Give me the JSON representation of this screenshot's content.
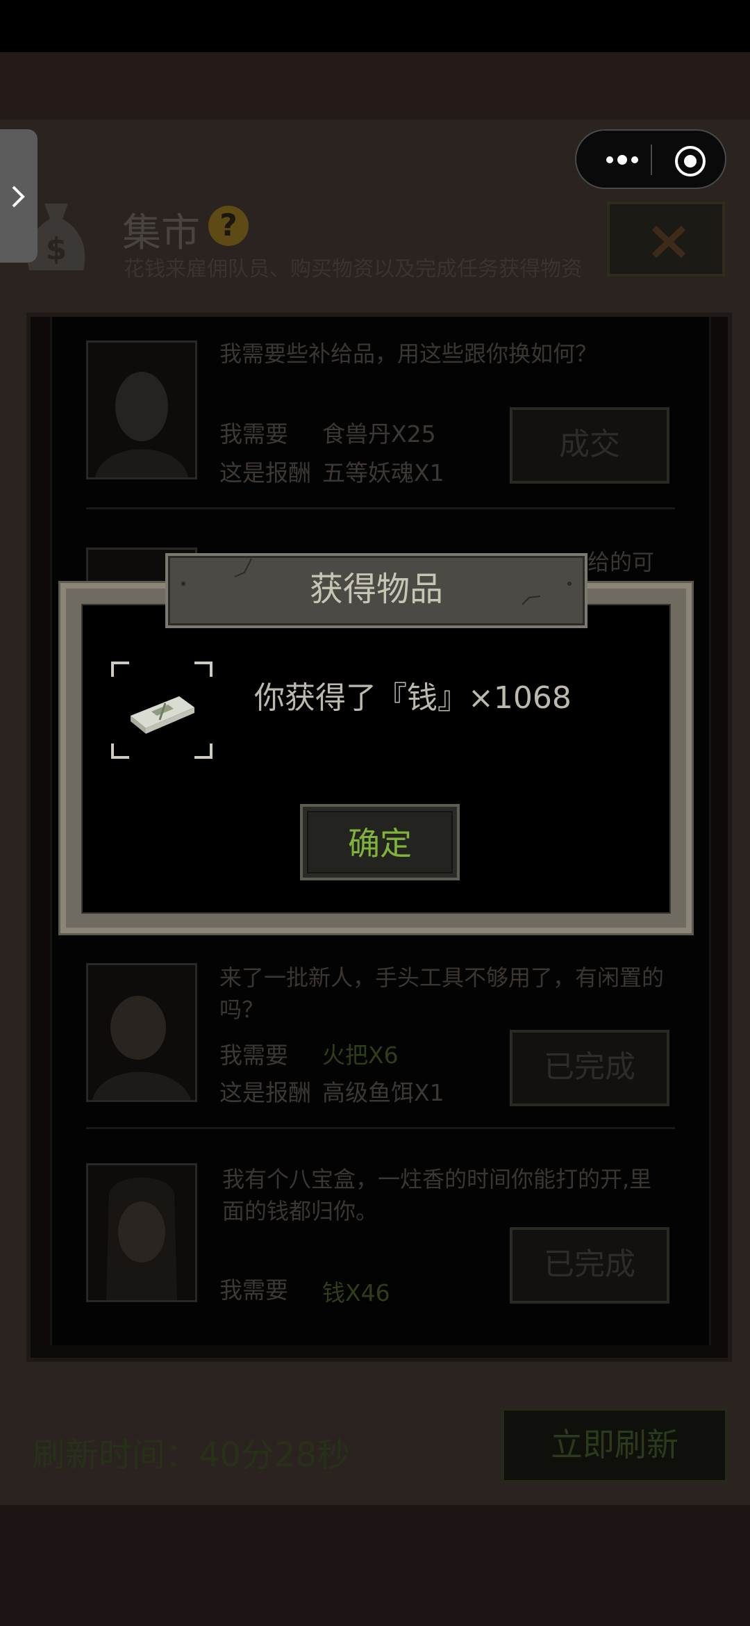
{
  "header": {
    "title": "集市",
    "help": "?",
    "subtitle": "花钱来雇佣队员、购买物资以及完成任务获得物资"
  },
  "trades": [
    {
      "text": "我需要些补给品，用这些跟你换如何？",
      "need_label": "我需要",
      "need_value": "食兽丹X25",
      "reward_label": "这是报酬",
      "reward_value": "五等妖魂X1",
      "button": "成交"
    },
    {
      "text_fragment": "给的可"
    },
    {
      "text": "来了一批新人，手头工具不够用了，有闲置的吗？",
      "need_label": "我需要",
      "need_value": "火把X6",
      "reward_label": "这是报酬",
      "reward_value": "高级鱼饵X1",
      "button": "已完成"
    },
    {
      "text": "我有个八宝盒，一炷香的时间你能打的开,里面的钱都归你。",
      "need_label": "我需要",
      "need_value": "钱X46",
      "button": "已完成"
    }
  ],
  "footer": {
    "refresh_time": "刷新时间：40分28秒",
    "refresh_button": "立即刷新"
  },
  "modal": {
    "title": "获得物品",
    "message": "你获得了『钱』×1068",
    "confirm": "确定"
  },
  "colors": {
    "accent_green": "#7fb33a",
    "modal_frame": "#8a8577"
  }
}
